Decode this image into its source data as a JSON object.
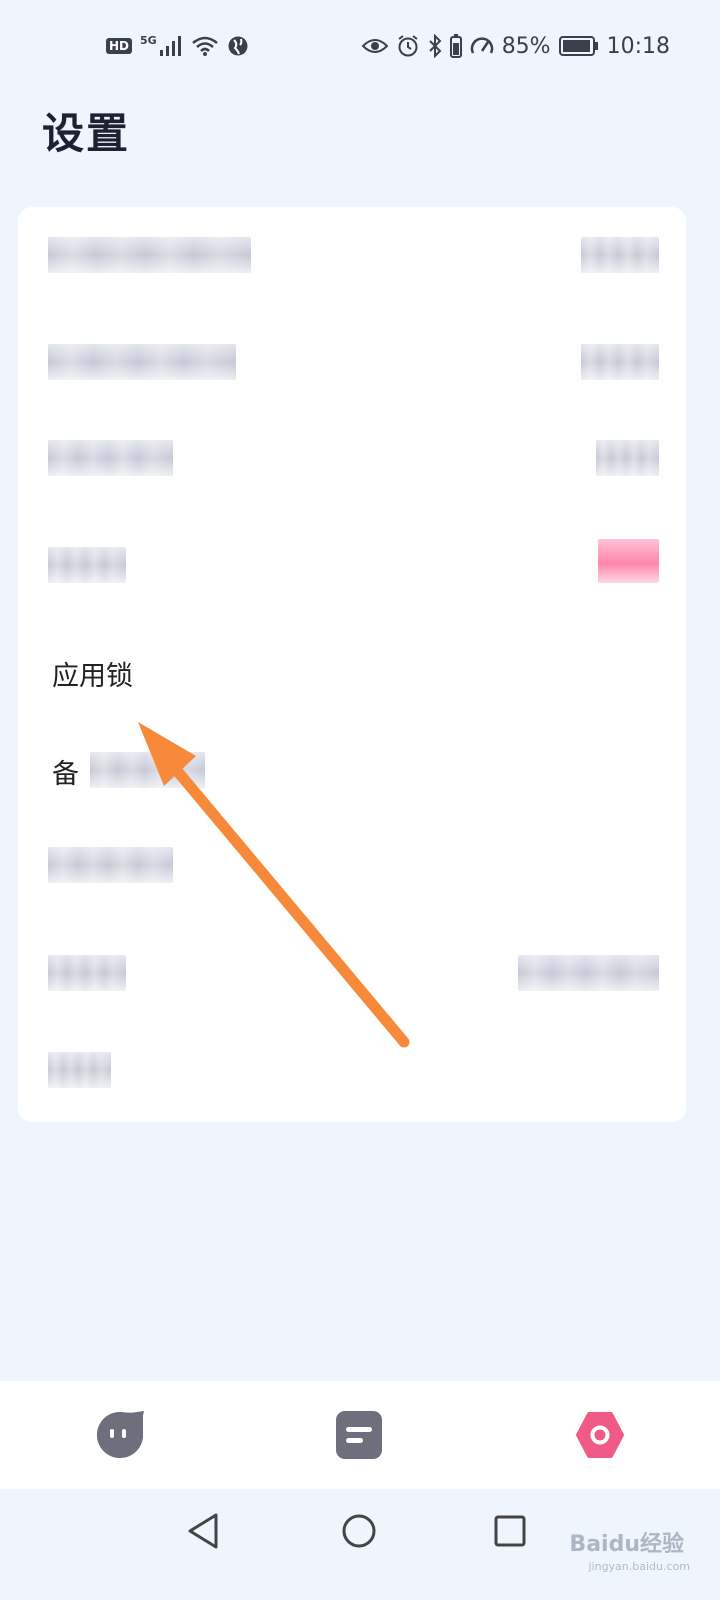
{
  "status_bar": {
    "hd": "HD",
    "network": "5G",
    "battery_percent": "85%",
    "time": "10:18"
  },
  "page": {
    "title": "设置"
  },
  "settings": {
    "rows": [
      {
        "label": ""
      },
      {
        "label": ""
      },
      {
        "label": ""
      },
      {
        "label": ""
      },
      {
        "label": "应用锁"
      },
      {
        "label": "备"
      },
      {
        "label": ""
      },
      {
        "label": ""
      },
      {
        "label": ""
      }
    ]
  },
  "tab_bar": {
    "tabs": [
      {
        "icon": "chat-bubble-face-icon",
        "active": false
      },
      {
        "icon": "notes-icon",
        "active": false
      },
      {
        "icon": "settings-hexagon-icon",
        "active": true
      }
    ],
    "active_color": "#f05a86",
    "inactive_color": "#6d707c"
  },
  "nav_bar": {
    "buttons": [
      "back-icon",
      "home-icon",
      "recents-icon"
    ]
  },
  "watermark": {
    "text": "Baidu经验",
    "sub": "jingyan.baidu.com"
  },
  "colors": {
    "background": "#eef5fd",
    "card": "#ffffff",
    "arrow": "#f68a3a"
  }
}
